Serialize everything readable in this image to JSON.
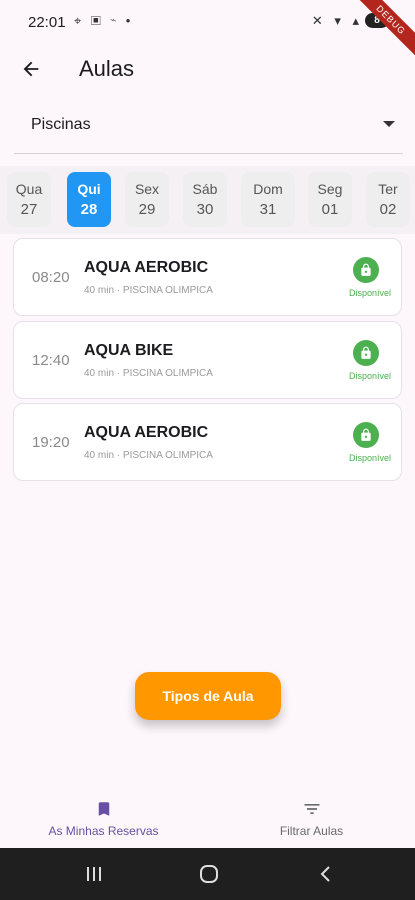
{
  "status_bar": {
    "time": "22:01",
    "left_icons": "⌖ ▣ ⌁ •",
    "right_icons": "✕ ▾ ▴",
    "battery": "8",
    "debug_banner": "DEBUG"
  },
  "app_bar": {
    "title": "Aulas",
    "back_icon": "arrow-left-icon"
  },
  "filter": {
    "selected_value": "Piscinas"
  },
  "days": [
    {
      "name": "Qua",
      "num": "27",
      "selected": false
    },
    {
      "name": "Qui",
      "num": "28",
      "selected": true
    },
    {
      "name": "Sex",
      "num": "29",
      "selected": false
    },
    {
      "name": "Sáb",
      "num": "30",
      "selected": false
    },
    {
      "name": "Dom",
      "num": "31",
      "selected": false
    },
    {
      "name": "Seg",
      "num": "01",
      "selected": false
    },
    {
      "name": "Ter",
      "num": "02",
      "selected": false
    }
  ],
  "classes": [
    {
      "time": "08:20",
      "title": "AQUA AEROBIC",
      "meta": "40 min  ·  PISCINA OLIMPICA",
      "status": "Disponível"
    },
    {
      "time": "12:40",
      "title": "AQUA BIKE",
      "meta": "40 min  ·  PISCINA OLIMPICA",
      "status": "Disponível"
    },
    {
      "time": "19:20",
      "title": "AQUA AEROBIC",
      "meta": "40 min  ·  PISCINA OLIMPICA",
      "status": "Disponível"
    }
  ],
  "fab": {
    "label": "Tipos de Aula"
  },
  "bottom_nav": [
    {
      "label": "As Minhas Reservas",
      "icon": "bookmark-icon",
      "active": true
    },
    {
      "label": "Filtrar Aulas",
      "icon": "filter-icon",
      "active": false
    }
  ],
  "colors": {
    "accent_blue": "#2196f3",
    "available_green": "#4caf50",
    "fab_orange": "#ff9800",
    "nav_active_purple": "#6750a4"
  }
}
